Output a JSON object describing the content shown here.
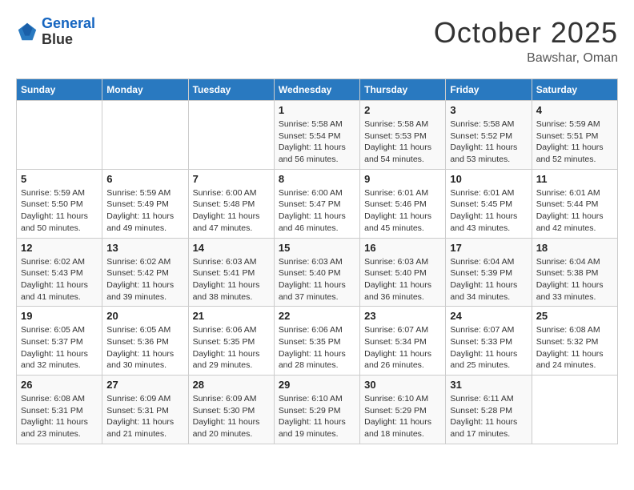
{
  "logo": {
    "line1": "General",
    "line2": "Blue"
  },
  "title": "October 2025",
  "location": "Bawshar, Oman",
  "headers": [
    "Sunday",
    "Monday",
    "Tuesday",
    "Wednesday",
    "Thursday",
    "Friday",
    "Saturday"
  ],
  "weeks": [
    [
      {
        "day": "",
        "detail": ""
      },
      {
        "day": "",
        "detail": ""
      },
      {
        "day": "",
        "detail": ""
      },
      {
        "day": "1",
        "detail": "Sunrise: 5:58 AM\nSunset: 5:54 PM\nDaylight: 11 hours\nand 56 minutes."
      },
      {
        "day": "2",
        "detail": "Sunrise: 5:58 AM\nSunset: 5:53 PM\nDaylight: 11 hours\nand 54 minutes."
      },
      {
        "day": "3",
        "detail": "Sunrise: 5:58 AM\nSunset: 5:52 PM\nDaylight: 11 hours\nand 53 minutes."
      },
      {
        "day": "4",
        "detail": "Sunrise: 5:59 AM\nSunset: 5:51 PM\nDaylight: 11 hours\nand 52 minutes."
      }
    ],
    [
      {
        "day": "5",
        "detail": "Sunrise: 5:59 AM\nSunset: 5:50 PM\nDaylight: 11 hours\nand 50 minutes."
      },
      {
        "day": "6",
        "detail": "Sunrise: 5:59 AM\nSunset: 5:49 PM\nDaylight: 11 hours\nand 49 minutes."
      },
      {
        "day": "7",
        "detail": "Sunrise: 6:00 AM\nSunset: 5:48 PM\nDaylight: 11 hours\nand 47 minutes."
      },
      {
        "day": "8",
        "detail": "Sunrise: 6:00 AM\nSunset: 5:47 PM\nDaylight: 11 hours\nand 46 minutes."
      },
      {
        "day": "9",
        "detail": "Sunrise: 6:01 AM\nSunset: 5:46 PM\nDaylight: 11 hours\nand 45 minutes."
      },
      {
        "day": "10",
        "detail": "Sunrise: 6:01 AM\nSunset: 5:45 PM\nDaylight: 11 hours\nand 43 minutes."
      },
      {
        "day": "11",
        "detail": "Sunrise: 6:01 AM\nSunset: 5:44 PM\nDaylight: 11 hours\nand 42 minutes."
      }
    ],
    [
      {
        "day": "12",
        "detail": "Sunrise: 6:02 AM\nSunset: 5:43 PM\nDaylight: 11 hours\nand 41 minutes."
      },
      {
        "day": "13",
        "detail": "Sunrise: 6:02 AM\nSunset: 5:42 PM\nDaylight: 11 hours\nand 39 minutes."
      },
      {
        "day": "14",
        "detail": "Sunrise: 6:03 AM\nSunset: 5:41 PM\nDaylight: 11 hours\nand 38 minutes."
      },
      {
        "day": "15",
        "detail": "Sunrise: 6:03 AM\nSunset: 5:40 PM\nDaylight: 11 hours\nand 37 minutes."
      },
      {
        "day": "16",
        "detail": "Sunrise: 6:03 AM\nSunset: 5:40 PM\nDaylight: 11 hours\nand 36 minutes."
      },
      {
        "day": "17",
        "detail": "Sunrise: 6:04 AM\nSunset: 5:39 PM\nDaylight: 11 hours\nand 34 minutes."
      },
      {
        "day": "18",
        "detail": "Sunrise: 6:04 AM\nSunset: 5:38 PM\nDaylight: 11 hours\nand 33 minutes."
      }
    ],
    [
      {
        "day": "19",
        "detail": "Sunrise: 6:05 AM\nSunset: 5:37 PM\nDaylight: 11 hours\nand 32 minutes."
      },
      {
        "day": "20",
        "detail": "Sunrise: 6:05 AM\nSunset: 5:36 PM\nDaylight: 11 hours\nand 30 minutes."
      },
      {
        "day": "21",
        "detail": "Sunrise: 6:06 AM\nSunset: 5:35 PM\nDaylight: 11 hours\nand 29 minutes."
      },
      {
        "day": "22",
        "detail": "Sunrise: 6:06 AM\nSunset: 5:35 PM\nDaylight: 11 hours\nand 28 minutes."
      },
      {
        "day": "23",
        "detail": "Sunrise: 6:07 AM\nSunset: 5:34 PM\nDaylight: 11 hours\nand 26 minutes."
      },
      {
        "day": "24",
        "detail": "Sunrise: 6:07 AM\nSunset: 5:33 PM\nDaylight: 11 hours\nand 25 minutes."
      },
      {
        "day": "25",
        "detail": "Sunrise: 6:08 AM\nSunset: 5:32 PM\nDaylight: 11 hours\nand 24 minutes."
      }
    ],
    [
      {
        "day": "26",
        "detail": "Sunrise: 6:08 AM\nSunset: 5:31 PM\nDaylight: 11 hours\nand 23 minutes."
      },
      {
        "day": "27",
        "detail": "Sunrise: 6:09 AM\nSunset: 5:31 PM\nDaylight: 11 hours\nand 21 minutes."
      },
      {
        "day": "28",
        "detail": "Sunrise: 6:09 AM\nSunset: 5:30 PM\nDaylight: 11 hours\nand 20 minutes."
      },
      {
        "day": "29",
        "detail": "Sunrise: 6:10 AM\nSunset: 5:29 PM\nDaylight: 11 hours\nand 19 minutes."
      },
      {
        "day": "30",
        "detail": "Sunrise: 6:10 AM\nSunset: 5:29 PM\nDaylight: 11 hours\nand 18 minutes."
      },
      {
        "day": "31",
        "detail": "Sunrise: 6:11 AM\nSunset: 5:28 PM\nDaylight: 11 hours\nand 17 minutes."
      },
      {
        "day": "",
        "detail": ""
      }
    ]
  ]
}
